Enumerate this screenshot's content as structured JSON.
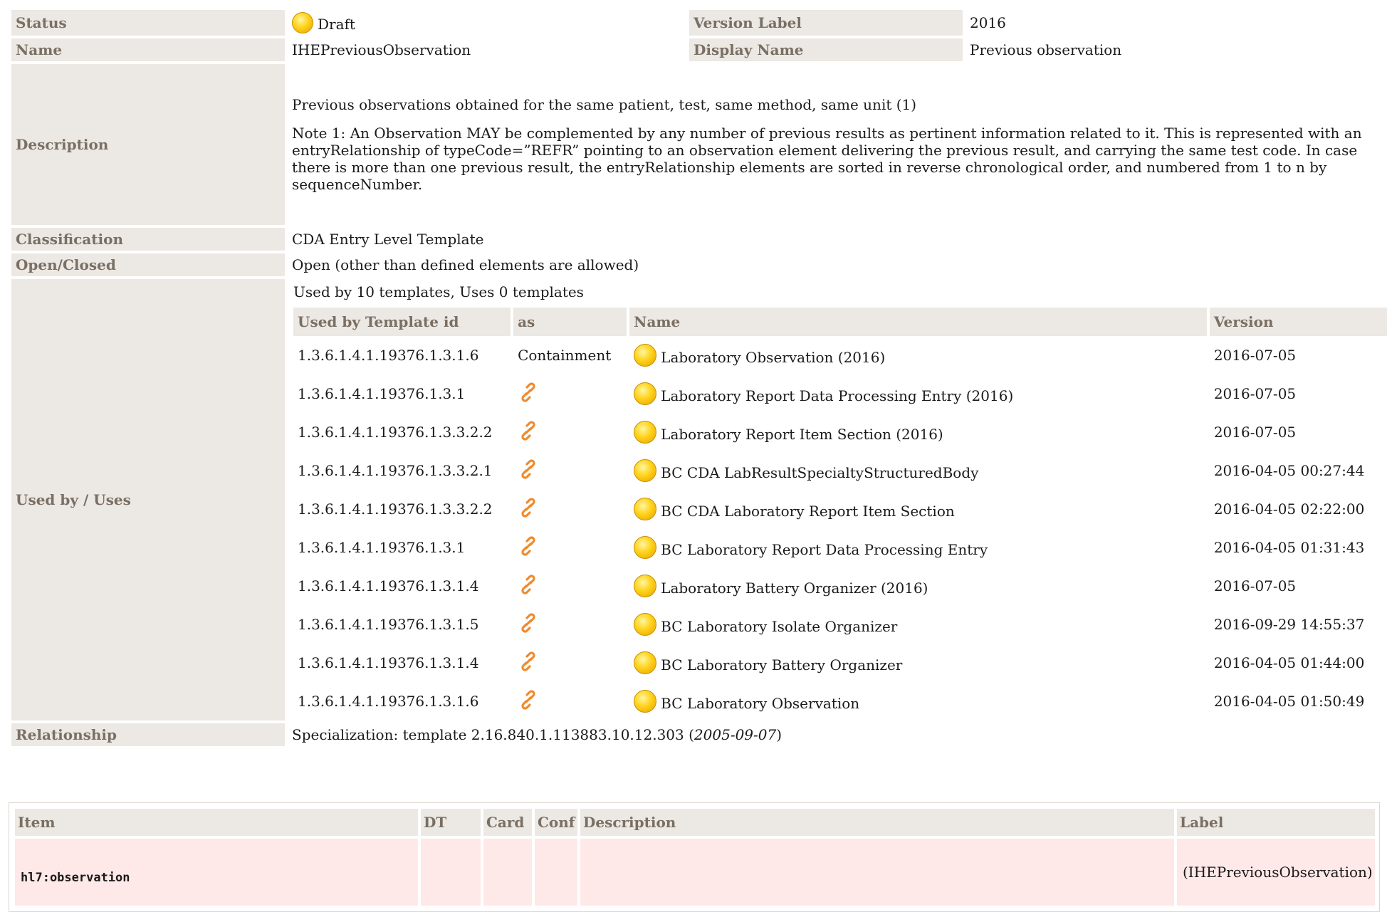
{
  "meta": {
    "status_label": "Status",
    "status_value": "Draft",
    "version_label_label": "Version Label",
    "version_label_value": "2016",
    "name_label": "Name",
    "name_value": "IHEPreviousObservation",
    "display_name_label": "Display Name",
    "display_name_value": "Previous observation",
    "description_label": "Description",
    "description_p1": "Previous observations obtained for the same patient, test, same method, same unit (1)",
    "description_p2": "Note 1: An Observation MAY be complemented by any number of previous results as pertinent information related to it. This is represented with an entryRelationship of typeCode=”REFR” pointing to an observation element delivering the previous result, and carrying the same test code. In case there is more than one previous result, the entryRelationship elements are sorted in reverse chronological order, and numbered from 1 to n by sequenceNumber.",
    "classification_label": "Classification",
    "classification_value": "CDA Entry Level Template",
    "open_closed_label": "Open/Closed",
    "open_closed_value": "Open (other than defined elements are allowed)",
    "used_by_label": "Used by / Uses",
    "relationship_label": "Relationship",
    "relationship_prefix": "Specialization: template 2.16.840.1.113883.10.12.303 (",
    "relationship_date": "2005-09-07",
    "relationship_suffix": ")"
  },
  "used_by": {
    "summary": "Used by 10 templates, Uses 0 templates",
    "headers": {
      "template_id": "Used by Template id",
      "as": "as",
      "name": "Name",
      "version": "Version"
    },
    "rows": [
      {
        "template_id": "1.3.6.1.4.1.19376.1.3.1.6",
        "as": "Containment",
        "name": "Laboratory Observation (2016)",
        "version": "2016-07-05"
      },
      {
        "template_id": "1.3.6.1.4.1.19376.1.3.1",
        "as": "",
        "name": "Laboratory Report Data Processing Entry (2016)",
        "version": "2016-07-05"
      },
      {
        "template_id": "1.3.6.1.4.1.19376.1.3.3.2.2",
        "as": "",
        "name": "Laboratory Report Item Section (2016)",
        "version": "2016-07-05"
      },
      {
        "template_id": "1.3.6.1.4.1.19376.1.3.3.2.1",
        "as": "",
        "name": "BC CDA LabResultSpecialtyStructuredBody",
        "version": "2016-04-05 00:27:44"
      },
      {
        "template_id": "1.3.6.1.4.1.19376.1.3.3.2.2",
        "as": "",
        "name": "BC CDA Laboratory Report Item Section",
        "version": "2016-04-05 02:22:00"
      },
      {
        "template_id": "1.3.6.1.4.1.19376.1.3.1",
        "as": "",
        "name": "BC Laboratory Report Data Processing Entry",
        "version": "2016-04-05 01:31:43"
      },
      {
        "template_id": "1.3.6.1.4.1.19376.1.3.1.4",
        "as": "",
        "name": "Laboratory Battery Organizer (2016)",
        "version": "2016-07-05"
      },
      {
        "template_id": "1.3.6.1.4.1.19376.1.3.1.5",
        "as": "",
        "name": "BC Laboratory Isolate Organizer",
        "version": "2016-09-29 14:55:37"
      },
      {
        "template_id": "1.3.6.1.4.1.19376.1.3.1.4",
        "as": "",
        "name": "BC Laboratory Battery Organizer",
        "version": "2016-04-05 01:44:00"
      },
      {
        "template_id": "1.3.6.1.4.1.19376.1.3.1.6",
        "as": "",
        "name": "BC Laboratory Observation",
        "version": "2016-04-05 01:50:49"
      }
    ]
  },
  "items": {
    "headers": {
      "item": "Item",
      "dt": "DT",
      "card": "Card",
      "conf": "Conf",
      "description": "Description",
      "label": "Label"
    },
    "row": {
      "item": "hl7:observation",
      "dt": "",
      "card": "",
      "conf": "",
      "description": "",
      "label": "(IHEPreviousObservation)"
    }
  },
  "icons": {
    "status": "draft-status-icon",
    "template_bullet": "draft-template-icon",
    "link": "chain-link-icon"
  },
  "colors": {
    "label_bg": "#ece8e3",
    "label_text": "#7a6f64",
    "item_row_bg": "#ffe8e8",
    "link_icon": "#f08a2c",
    "status_yellow": "#ffd21a"
  }
}
